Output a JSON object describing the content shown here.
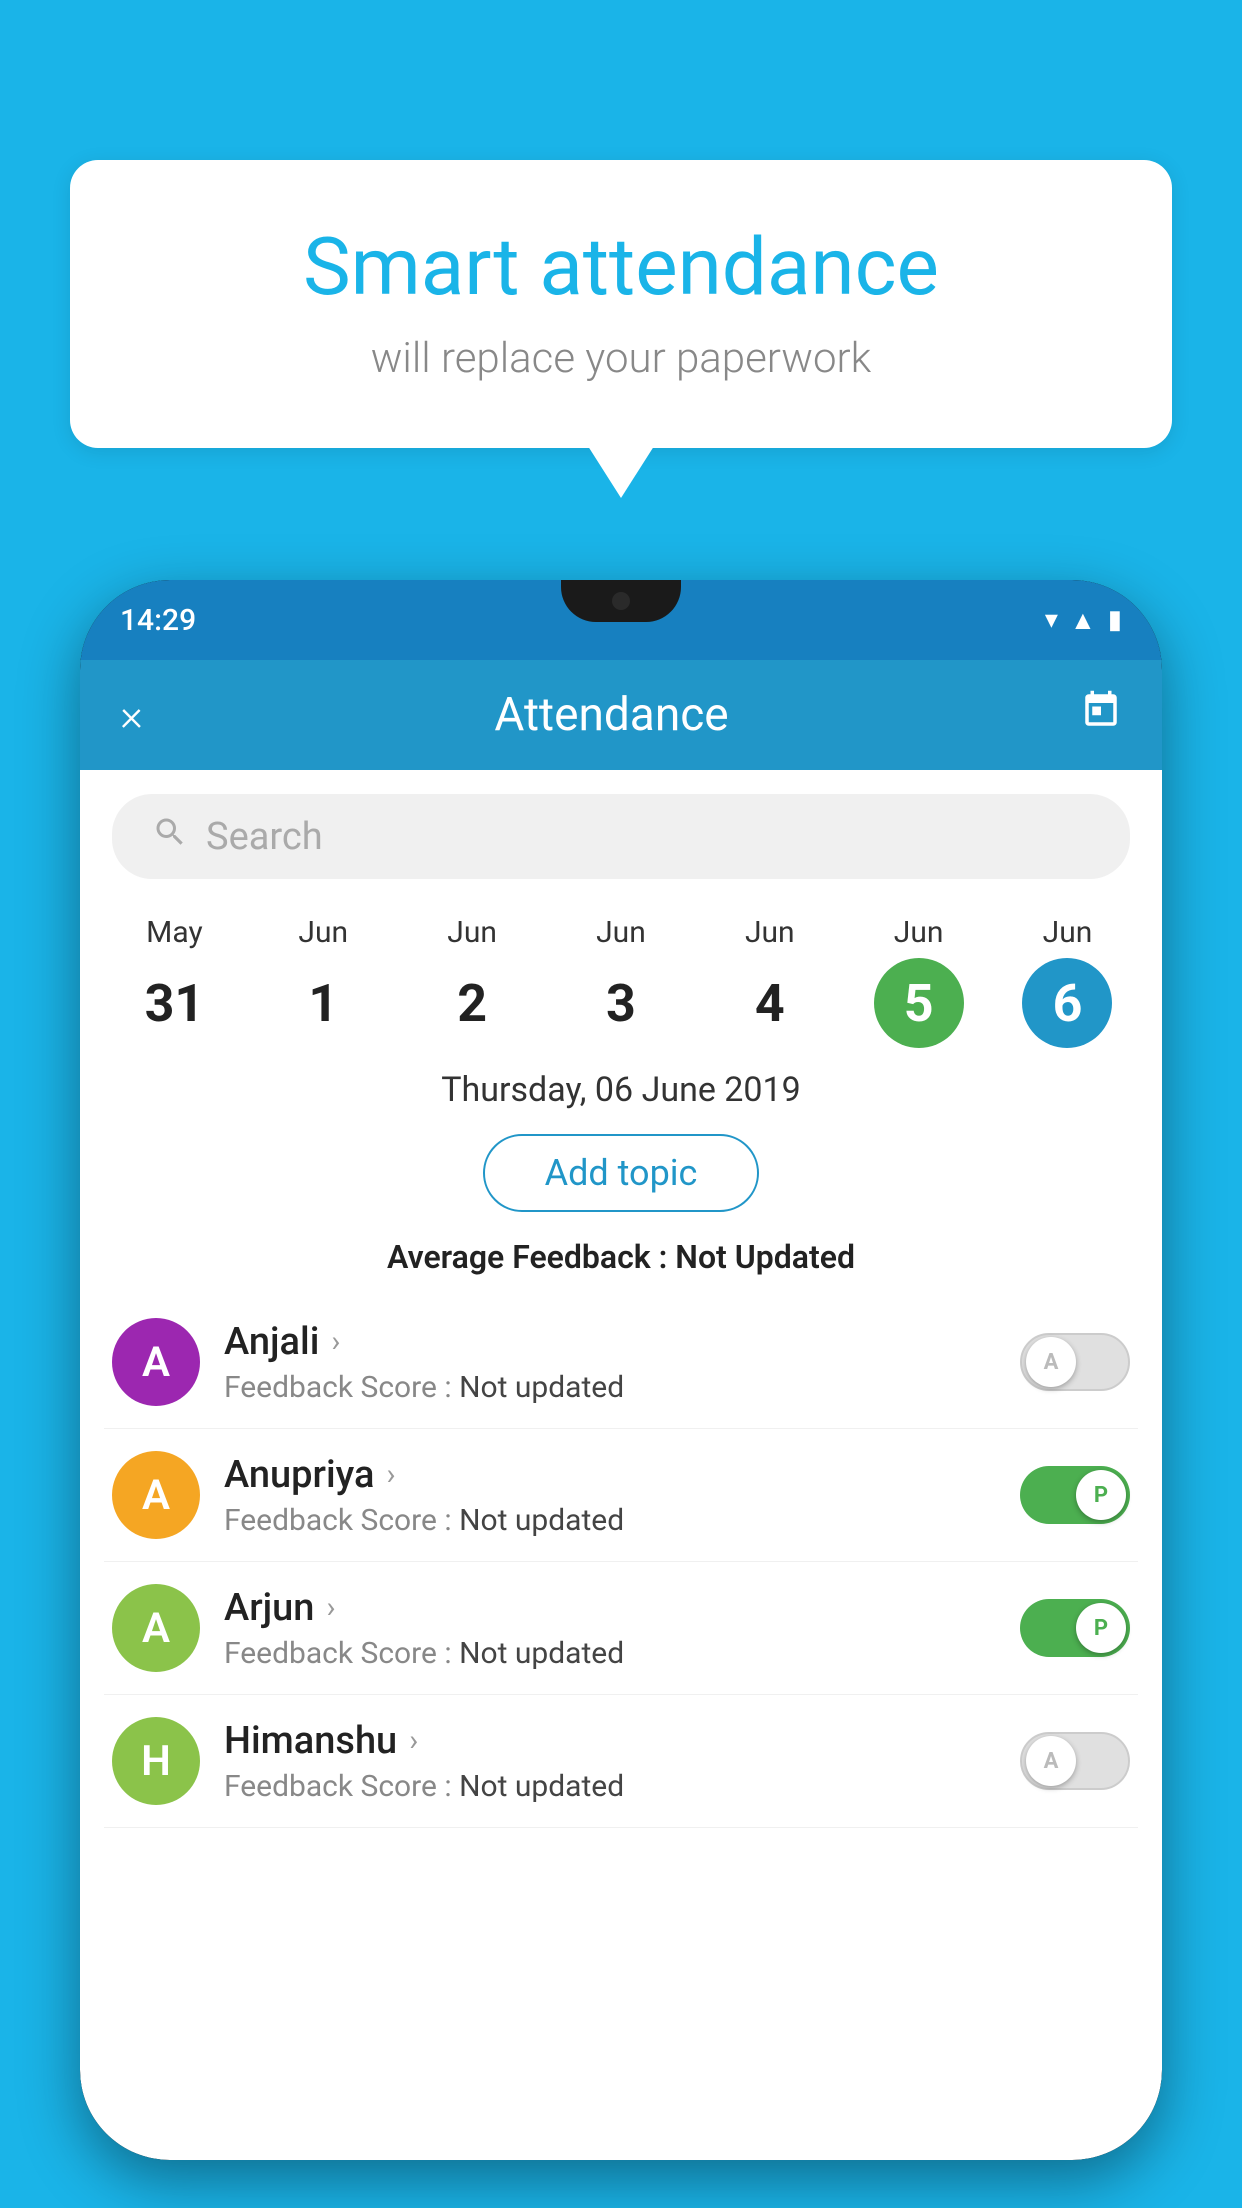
{
  "background_color": "#1ab4e8",
  "speech_bubble": {
    "title": "Smart attendance",
    "subtitle": "will replace your paperwork"
  },
  "phone": {
    "status_bar": {
      "time": "14:29",
      "icons": [
        "wifi",
        "signal",
        "battery"
      ]
    },
    "header": {
      "close_label": "×",
      "title": "Attendance",
      "calendar_icon": "📅"
    },
    "search": {
      "placeholder": "Search"
    },
    "calendar": {
      "days": [
        {
          "month": "May",
          "date": "31",
          "state": "normal"
        },
        {
          "month": "Jun",
          "date": "1",
          "state": "normal"
        },
        {
          "month": "Jun",
          "date": "2",
          "state": "normal"
        },
        {
          "month": "Jun",
          "date": "3",
          "state": "normal"
        },
        {
          "month": "Jun",
          "date": "4",
          "state": "normal"
        },
        {
          "month": "Jun",
          "date": "5",
          "state": "today"
        },
        {
          "month": "Jun",
          "date": "6",
          "state": "selected"
        }
      ]
    },
    "selected_date_label": "Thursday, 06 June 2019",
    "add_topic_label": "Add topic",
    "avg_feedback_label": "Average Feedback :",
    "avg_feedback_value": "Not Updated",
    "students": [
      {
        "name": "Anjali",
        "initial": "A",
        "avatar_color": "#9c27b0",
        "feedback_label": "Feedback Score :",
        "feedback_value": "Not updated",
        "toggle_state": "off",
        "toggle_label": "A"
      },
      {
        "name": "Anupriya",
        "initial": "A",
        "avatar_color": "#f5a623",
        "feedback_label": "Feedback Score :",
        "feedback_value": "Not updated",
        "toggle_state": "on",
        "toggle_label": "P"
      },
      {
        "name": "Arjun",
        "initial": "A",
        "avatar_color": "#8bc34a",
        "feedback_label": "Feedback Score :",
        "feedback_value": "Not updated",
        "toggle_state": "on",
        "toggle_label": "P"
      },
      {
        "name": "Himanshu",
        "initial": "H",
        "avatar_color": "#8bc34a",
        "feedback_label": "Feedback Score :",
        "feedback_value": "Not updated",
        "toggle_state": "off",
        "toggle_label": "A"
      }
    ]
  }
}
